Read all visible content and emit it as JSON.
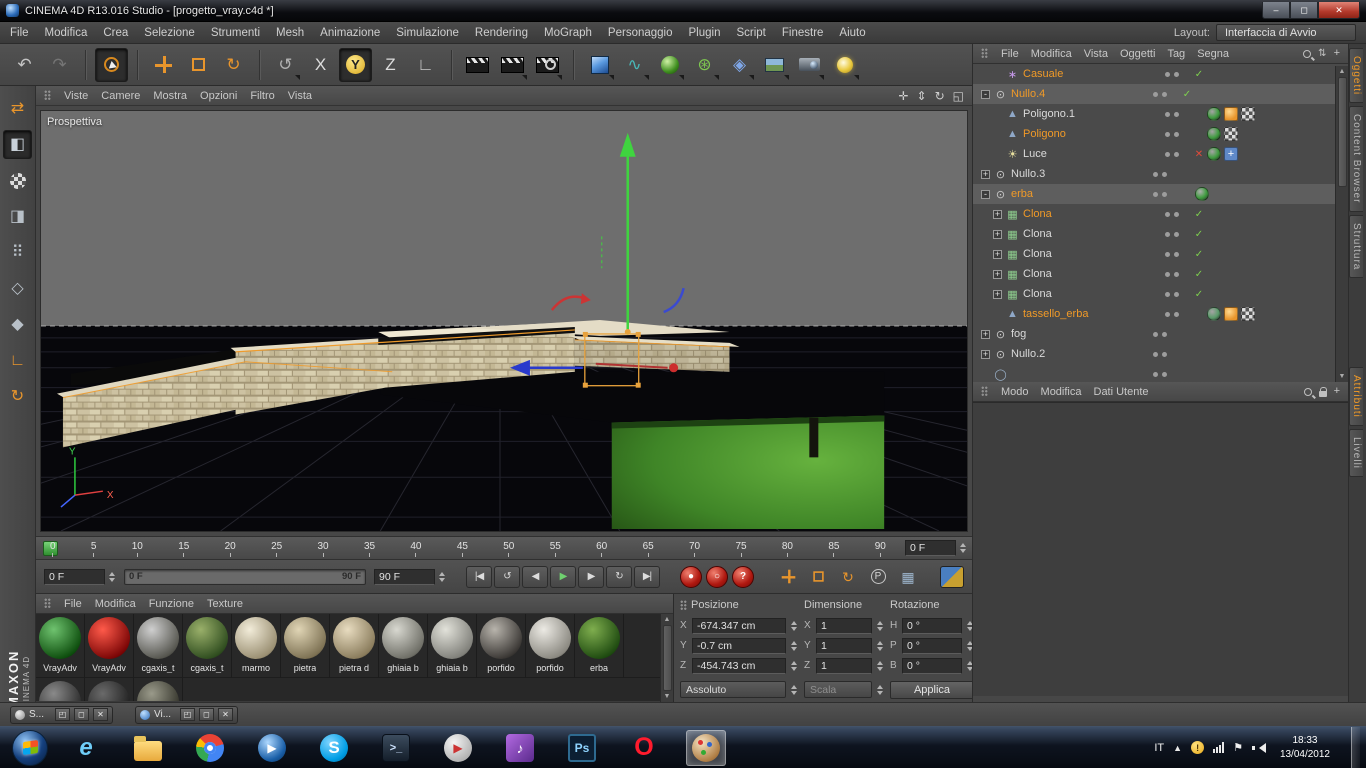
{
  "window": {
    "title": "CINEMA 4D R13.016 Studio - [progetto_vray.c4d *]",
    "controls": {
      "minimize": "–",
      "maximize": "◻",
      "close": "✕"
    }
  },
  "menu_bar": {
    "items": [
      "File",
      "Modifica",
      "Crea",
      "Selezione",
      "Strumenti",
      "Mesh",
      "Animazione",
      "Simulazione",
      "Rendering",
      "MoGraph",
      "Personaggio",
      "Plugin",
      "Script",
      "Finestre",
      "Aiuto"
    ],
    "layout_label": "Layout:",
    "layout_value": "Interfaccia di Avvio"
  },
  "toolbar": {
    "g_history": [
      {
        "name": "undo-button",
        "glyph": "↶",
        "fg": "#c4c4c4"
      },
      {
        "name": "redo-button",
        "glyph": "↷",
        "fg": "#757575"
      }
    ],
    "g_select": [
      {
        "name": "live-selection-button",
        "kind": "k-sel",
        "active": true
      }
    ],
    "g_transform": [
      {
        "name": "move-button",
        "kind": "k-move"
      },
      {
        "name": "scale-button",
        "kind": "k-scale"
      },
      {
        "name": "rotate-button",
        "glyph": "↻",
        "fg": "#e8952c"
      }
    ],
    "g_axis": [
      {
        "name": "tool-history-button",
        "glyph": "↺",
        "fg": "#b0b0b0",
        "dd": true
      },
      {
        "name": "lock-x-axis-button",
        "glyph": "X",
        "fg": "#dcdcdc"
      },
      {
        "name": "lock-y-axis-button",
        "glyph": "Y",
        "kind": "k-axisy",
        "active": true
      },
      {
        "name": "lock-z-axis-button",
        "glyph": "Z",
        "fg": "#dcdcdc"
      },
      {
        "name": "coordinate-system-button",
        "glyph": "∟",
        "fg": "#c8c8c8"
      }
    ],
    "g_render": [
      {
        "name": "render-view-button",
        "kind": "k-clap"
      },
      {
        "name": "render-to-picture-viewer-button",
        "kind": "k-clap",
        "dd": true
      },
      {
        "name": "render-settings-button",
        "kind": "k-clap",
        "gear": true,
        "dd": true
      }
    ],
    "g_create": [
      {
        "name": "add-cube-button",
        "kind": "k-cube",
        "dd": true
      },
      {
        "name": "add-spline-button",
        "glyph": "∿",
        "fg": "#49b8b8",
        "dd": true
      },
      {
        "name": "subdivision-surface-button",
        "kind": "k-sphg",
        "dd": true
      },
      {
        "name": "mograph-button",
        "glyph": "⊛",
        "fg": "#7ec850",
        "dd": true
      },
      {
        "name": "deformer-button",
        "glyph": "◈",
        "fg": "#7fa7e8",
        "dd": true
      },
      {
        "name": "environment-button",
        "kind": "k-floor",
        "dd": true
      },
      {
        "name": "camera-button",
        "kind": "k-cam",
        "dd": true
      },
      {
        "name": "light-button",
        "kind": "k-bulb",
        "dd": true
      }
    ]
  },
  "left_tools": [
    {
      "name": "make-editable-button",
      "glyph": "⇄",
      "fg": "#e8952c"
    },
    {
      "name": "model-mode-button",
      "glyph": "◧",
      "fg": "#c8d0d8",
      "active": true
    },
    {
      "name": "texture-mode-button",
      "kind": "k-checker"
    },
    {
      "name": "workplane-mode-button",
      "glyph": "◨",
      "fg": "#b8c0c8"
    },
    {
      "name": "points-mode-button",
      "glyph": "⠿",
      "fg": "#b8c0c8"
    },
    {
      "name": "edges-mode-button",
      "glyph": "◇",
      "fg": "#b8c0c8"
    },
    {
      "name": "polygons-mode-button",
      "glyph": "◆",
      "fg": "#b8c0c8"
    },
    {
      "name": "enable-axis-button",
      "glyph": "∟",
      "fg": "#e8952c"
    },
    {
      "name": "rotate-workplane-button",
      "glyph": "↻",
      "fg": "#e8952c"
    }
  ],
  "viewport": {
    "menus": [
      "Viste",
      "Camere",
      "Mostra",
      "Opzioni",
      "Filtro",
      "Vista"
    ],
    "camera_label": "Prospettiva",
    "corner_icons": [
      {
        "name": "pan-view-button",
        "glyph": "✛"
      },
      {
        "name": "dolly-view-button",
        "glyph": "⇕"
      },
      {
        "name": "rotate-view-button",
        "glyph": "↻"
      },
      {
        "name": "toggle-view-button",
        "glyph": "◱"
      }
    ]
  },
  "timeline": {
    "ticks": [
      "0",
      "5",
      "10",
      "15",
      "20",
      "25",
      "30",
      "35",
      "40",
      "45",
      "50",
      "55",
      "60",
      "65",
      "70",
      "75",
      "80",
      "85",
      "90"
    ],
    "frame_field": "0 F",
    "current_frame": "0 F",
    "range_start": "0 F",
    "range_end": "90 F",
    "end_field": "90 F"
  },
  "controls_bar": {
    "playback": [
      {
        "name": "goto-start-button",
        "glyph": "|◀",
        "fg": "#dcdcdc"
      },
      {
        "name": "prev-key-button",
        "glyph": "↺",
        "fg": "#dcdcdc"
      },
      {
        "name": "prev-frame-button",
        "glyph": "◀",
        "fg": "#dcdcdc"
      },
      {
        "name": "play-button",
        "glyph": "▶",
        "fg": "#6fd06f"
      },
      {
        "name": "next-frame-button",
        "glyph": "▶",
        "fg": "#dcdcdc"
      },
      {
        "name": "next-key-button",
        "glyph": "↻",
        "fg": "#dcdcdc"
      },
      {
        "name": "goto-end-button",
        "glyph": "▶|",
        "fg": "#dcdcdc"
      }
    ],
    "records": [
      {
        "name": "record-keyframe-button",
        "glyph": "●"
      },
      {
        "name": "autokeying-button",
        "glyph": "○"
      },
      {
        "name": "record-help-button",
        "glyph": "?"
      }
    ],
    "toggles": [
      {
        "name": "key-position-toggle",
        "kind": "k-move"
      },
      {
        "name": "key-scale-toggle",
        "kind": "k-scale"
      },
      {
        "name": "key-rotation-toggle",
        "glyph": "↻",
        "fg": "#e8952c"
      },
      {
        "name": "key-parameter-toggle",
        "glyph": "P",
        "fg": "#d8d8d8",
        "ring": true
      },
      {
        "name": "key-pla-toggle",
        "glyph": "▦",
        "fg": "#9fb8d0"
      }
    ]
  },
  "materials": {
    "menus": [
      "File",
      "Modifica",
      "Funzione",
      "Texture"
    ],
    "items": [
      {
        "name": "VrayAdv",
        "c1": "#6fc36f",
        "c2": "#0d4d0d"
      },
      {
        "name": "VrayAdv",
        "c1": "#ff5a4a",
        "c2": "#7a0505"
      },
      {
        "name": "cgaxis_t",
        "c1": "#cfcfcf",
        "c2": "#55554e"
      },
      {
        "name": "cgaxis_t",
        "c1": "#9ab06a",
        "c2": "#2f4d1f"
      },
      {
        "name": "marmo",
        "c1": "#f2ecd9",
        "c2": "#9a8f72"
      },
      {
        "name": "pietra",
        "c1": "#e0d5b5",
        "c2": "#7d7153"
      },
      {
        "name": "pietra d",
        "c1": "#e8dcc0",
        "c2": "#8a7c5c"
      },
      {
        "name": "ghiaia b",
        "c1": "#d8d8d0",
        "c2": "#6e6e66"
      },
      {
        "name": "ghiaia b",
        "c1": "#e2e2da",
        "c2": "#80807a"
      },
      {
        "name": "porfido",
        "c1": "#b8b4ac",
        "c2": "#3a3734"
      },
      {
        "name": "porfido",
        "c1": "#eceae4",
        "c2": "#8a8880"
      },
      {
        "name": "erba",
        "c1": "#7fae4e",
        "c2": "#1e4a10"
      }
    ],
    "items_row2": [
      {
        "name": "",
        "c1": "#8a8a8a",
        "c2": "#2a2a2a"
      },
      {
        "name": "",
        "c1": "#6a6a6a",
        "c2": "#1e1e1e"
      },
      {
        "name": "",
        "c1": "#9a9a8a",
        "c2": "#33332a"
      }
    ]
  },
  "coordinates": {
    "title_position": "Posizione",
    "title_dimension": "Dimensione",
    "title_rotation": "Rotazione",
    "position": [
      {
        "l": "X",
        "v": "-674.347 cm"
      },
      {
        "l": "Y",
        "v": "-0.7 cm"
      },
      {
        "l": "Z",
        "v": "-454.743 cm"
      }
    ],
    "dimension": [
      {
        "l": "X",
        "v": "1"
      },
      {
        "l": "Y",
        "v": "1"
      },
      {
        "l": "Z",
        "v": "1"
      }
    ],
    "rotation": [
      {
        "l": "H",
        "v": "0 °"
      },
      {
        "l": "P",
        "v": "0 °"
      },
      {
        "l": "B",
        "v": "0 °"
      }
    ],
    "mode_absolute": "Assoluto",
    "mode_scale": "Scala",
    "apply_label": "Applica"
  },
  "object_manager": {
    "menus": [
      "File",
      "Modifica",
      "Vista",
      "Oggetti",
      "Tag",
      "Segna"
    ],
    "items": [
      {
        "name": "object-casuale",
        "label": "Casuale",
        "orange": true,
        "depth": 1,
        "exp": "",
        "glyph": "∗",
        "ifg": "#c598e8",
        "state": "check",
        "chips": []
      },
      {
        "name": "object-nullo4",
        "label": "Nullo.4",
        "orange": true,
        "depth": 0,
        "exp": "-",
        "glyph": "⊙",
        "ifg": "#c8c8c8",
        "state": "check",
        "chips": [],
        "selbg": true
      },
      {
        "name": "object-poligono1",
        "label": "Poligono.1",
        "depth": 1,
        "exp": "",
        "glyph": "▲",
        "ifg": "#8fa8c8",
        "state": "",
        "chips": [
          "#3f9c3f",
          "phong",
          "checker"
        ]
      },
      {
        "name": "object-poligono",
        "label": "Poligono",
        "orange": true,
        "depth": 1,
        "exp": "",
        "glyph": "▲",
        "ifg": "#8fa8c8",
        "state": "",
        "chips": [
          "#3f9c3f",
          "checker"
        ]
      },
      {
        "name": "object-luce",
        "label": "Luce",
        "depth": 1,
        "exp": "",
        "glyph": "☀",
        "ifg": "#e8e09f",
        "state": "x",
        "chips": [
          "#3f9c3f",
          "star"
        ]
      },
      {
        "name": "object-nullo3",
        "label": "Nullo.3",
        "depth": 0,
        "exp": "+",
        "glyph": "⊙",
        "ifg": "#c8c8c8",
        "state": "",
        "chips": []
      },
      {
        "name": "object-erba",
        "label": "erba",
        "orange": true,
        "depth": 0,
        "exp": "-",
        "glyph": "⊙",
        "ifg": "#c8c8c8",
        "state": "",
        "chips": [
          "#3f9c3f"
        ],
        "selbg": true
      },
      {
        "name": "object-clona",
        "label": "Clona",
        "orange": true,
        "depth": 1,
        "exp": "+",
        "glyph": "▦",
        "ifg": "#8fd08f",
        "state": "check",
        "chips": []
      },
      {
        "name": "object-clona",
        "label": "Clona",
        "depth": 1,
        "exp": "+",
        "glyph": "▦",
        "ifg": "#8fd08f",
        "state": "check",
        "chips": []
      },
      {
        "name": "object-clona",
        "label": "Clona",
        "depth": 1,
        "exp": "+",
        "glyph": "▦",
        "ifg": "#8fd08f",
        "state": "check",
        "chips": []
      },
      {
        "name": "object-clona",
        "label": "Clona",
        "depth": 1,
        "exp": "+",
        "glyph": "▦",
        "ifg": "#8fd08f",
        "state": "check",
        "chips": []
      },
      {
        "name": "object-clona",
        "label": "Clona",
        "depth": 1,
        "exp": "+",
        "glyph": "▦",
        "ifg": "#8fd08f",
        "state": "check",
        "chips": []
      },
      {
        "name": "object-tassello-erba",
        "label": "tassello_erba",
        "orange": true,
        "depth": 1,
        "exp": "",
        "glyph": "▲",
        "ifg": "#8fa8c8",
        "state": "",
        "chips": [
          "#5a9c6a",
          "phong",
          "checker"
        ]
      },
      {
        "name": "object-fog",
        "label": "fog",
        "depth": 0,
        "exp": "+",
        "glyph": "⊙",
        "ifg": "#c8c8c8",
        "state": "",
        "chips": []
      },
      {
        "name": "object-nullo2",
        "label": "Nullo.2",
        "depth": 0,
        "exp": "+",
        "glyph": "⊙",
        "ifg": "#c8c8c8",
        "state": "",
        "chips": []
      },
      {
        "name": "object-partial",
        "label": "",
        "depth": 0,
        "exp": "",
        "glyph": "◯",
        "ifg": "#9ab0c8",
        "state": "",
        "chips": []
      }
    ]
  },
  "attribute_manager": {
    "menus": [
      "Modo",
      "Modifica",
      "Dati Utente"
    ]
  },
  "side_tabs": {
    "upper": [
      {
        "label": "Oggetti",
        "active": true
      },
      {
        "label": "Content Browser"
      },
      {
        "label": "Struttura"
      }
    ],
    "lower": [
      {
        "label": "Attributi",
        "active": true
      },
      {
        "label": "Livelli"
      }
    ]
  },
  "floating_windows": {
    "buttons": {
      "restore": "◰",
      "maximize": "◻",
      "close": "✕"
    },
    "items": [
      {
        "name": "floating-window-s",
        "label": "S...",
        "kind": ""
      },
      {
        "name": "floating-window-vi",
        "label": "Vi...",
        "kind": "w-blue"
      }
    ]
  },
  "branding": {
    "maxon": "MAXON",
    "c4d": "CINEMA 4D"
  },
  "taskbar": {
    "apps": [
      {
        "name": "taskbar-internet-explorer",
        "kind": "a-ie",
        "glyph": "e"
      },
      {
        "name": "taskbar-explorer-folder",
        "kind": "a-folder",
        "glyph": ""
      },
      {
        "name": "taskbar-chrome",
        "kind": "a-chrome",
        "glyph": ""
      },
      {
        "name": "taskbar-media-player",
        "kind": "a-wmp",
        "glyph": "▶"
      },
      {
        "name": "taskbar-skype",
        "kind": "a-skype",
        "glyph": "S"
      },
      {
        "name": "taskbar-console",
        "kind": "a-console",
        "glyph": ">_"
      },
      {
        "name": "taskbar-kmplayer",
        "kind": "a-km",
        "glyph": "▶"
      },
      {
        "name": "taskbar-media-purple",
        "kind": "a-mpc",
        "glyph": "♪"
      },
      {
        "name": "taskbar-photoshop",
        "kind": "a-ps",
        "glyph": "Ps"
      },
      {
        "name": "taskbar-opera",
        "kind": "a-opera",
        "glyph": "O"
      },
      {
        "name": "taskbar-cinema4d",
        "kind": "a-c4d",
        "glyph": "",
        "active": true
      }
    ],
    "tray": {
      "lang": "IT",
      "expand": "▲",
      "warn": "!",
      "flag": "⚑",
      "time": "18:33",
      "date": "13/04/2012"
    }
  }
}
